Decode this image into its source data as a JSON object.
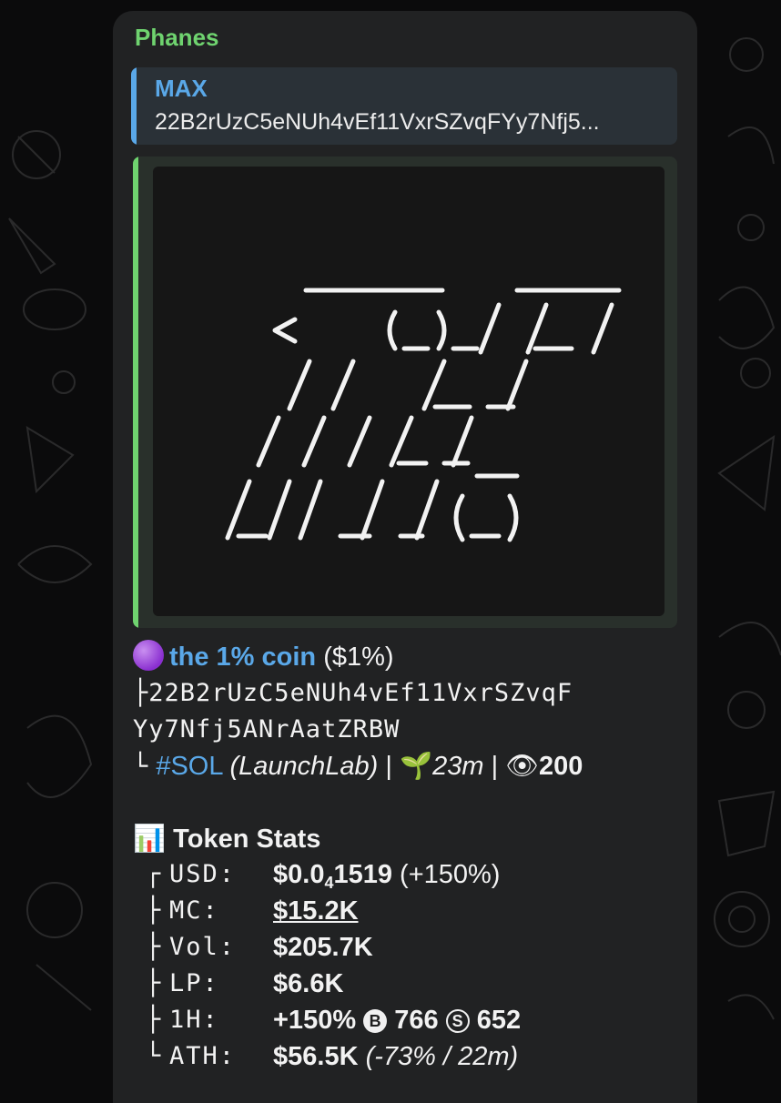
{
  "message": {
    "sender": "Phanes",
    "reply": {
      "name": "MAX",
      "text": "22B2rUzC5eNUh4vEf11VxrSZvqFYy7Nfj5..."
    },
    "token": {
      "name": "the 1% coin",
      "ticker": "($1%)",
      "address_line1": "22B2rUzC5eNUh4vEf11VxrSZvqF",
      "address_line2": "Yy7Nfj5ANrAatZRBW",
      "chain": "#SOL",
      "platform": "(LaunchLab)",
      "age": "23m",
      "views": "200"
    },
    "stats": {
      "title": "Token Stats",
      "usd_label": "USD:",
      "usd_value_a": "$0.0",
      "usd_value_sub": "4",
      "usd_value_b": "1519",
      "usd_change": "(+150%)",
      "mc_label": "MC:",
      "mc_value": "$15.2K",
      "vol_label": "Vol:",
      "vol_value": "$205.7K",
      "lp_label": "LP:",
      "lp_value": "$6.6K",
      "h1_label": "1H:",
      "h1_change": "+150%",
      "h1_buys": "766",
      "h1_sells": "652",
      "ath_label": "ATH:",
      "ath_value": "$56.5K",
      "ath_detail": "(-73% / 22m)"
    }
  },
  "colors": {
    "sender": "#6fd36f",
    "link": "#5aa8e8",
    "bubble": "#212223",
    "background": "#0b0b0c"
  }
}
